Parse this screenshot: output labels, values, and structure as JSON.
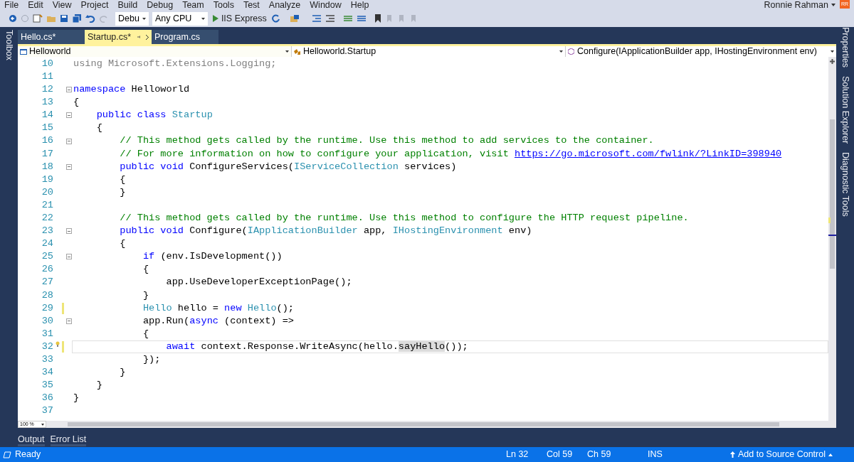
{
  "menu": [
    "File",
    "Edit",
    "View",
    "Project",
    "Build",
    "Debug",
    "Team",
    "Tools",
    "Test",
    "Analyze",
    "Window",
    "Help"
  ],
  "toolbar": {
    "configuration": "Debu",
    "platform": "Any CPU",
    "run_target": "IIS Express"
  },
  "user": {
    "name": "Ronnie Rahman",
    "initials": "RR"
  },
  "left_tabs": [
    "Toolbox"
  ],
  "doc_tabs": [
    {
      "label": "Hello.cs*",
      "selected": false
    },
    {
      "label": "Startup.cs*",
      "selected": true
    },
    {
      "label": "Program.cs",
      "selected": false
    }
  ],
  "nav": {
    "project": "Helloworld",
    "type": "Helloworld.Startup",
    "member": "Configure(IApplicationBuilder app, IHostingEnvironment env)"
  },
  "lines": [
    {
      "number": "10",
      "fold": false,
      "changed": false,
      "current": false,
      "lightbulb": false,
      "tokens": [
        {
          "kind": "dim",
          "text": "using Microsoft.Extensions.Logging;"
        }
      ]
    },
    {
      "number": "11",
      "fold": false,
      "changed": false,
      "current": false,
      "lightbulb": false
    },
    {
      "number": "12",
      "fold": true,
      "changed": false,
      "current": false,
      "lightbulb": false,
      "tokens": [
        {
          "kind": "kw",
          "text": "namespace"
        },
        {
          "kind": "p",
          "text": " Helloworld"
        }
      ]
    },
    {
      "number": "13",
      "fold": false,
      "changed": false,
      "current": false,
      "lightbulb": false,
      "tokens": [
        {
          "kind": "p",
          "text": "{"
        }
      ]
    },
    {
      "number": "14",
      "fold": true,
      "changed": false,
      "current": false,
      "lightbulb": false,
      "tokens": [
        {
          "kind": "kw",
          "text": "    public class"
        },
        {
          "kind": "ty",
          "text": " Startup"
        }
      ]
    },
    {
      "number": "15",
      "fold": false,
      "changed": false,
      "current": false,
      "lightbulb": false,
      "tokens": [
        {
          "kind": "p",
          "text": "    {"
        }
      ]
    },
    {
      "number": "16",
      "fold": true,
      "changed": false,
      "current": false,
      "lightbulb": false,
      "tokens": [
        {
          "kind": "cm",
          "text": "        // This method gets called by the runtime. Use this method to add services to the container."
        }
      ]
    },
    {
      "number": "17",
      "fold": false,
      "changed": false,
      "current": false,
      "lightbulb": false,
      "tokens": [
        {
          "kind": "cm",
          "text": "        // For more information on how to configure your application, visit "
        },
        {
          "kind": "link",
          "text": "https://go.microsoft.com/fwlink/?LinkID=398940"
        }
      ]
    },
    {
      "number": "18",
      "fold": true,
      "changed": false,
      "current": false,
      "lightbulb": false,
      "tokens": [
        {
          "kind": "kw",
          "text": "        public void"
        },
        {
          "kind": "p",
          "text": " ConfigureServices("
        },
        {
          "kind": "ty",
          "text": "IServiceCollection"
        },
        {
          "kind": "p",
          "text": " services)"
        }
      ]
    },
    {
      "number": "19",
      "fold": false,
      "changed": false,
      "current": false,
      "lightbulb": false,
      "tokens": [
        {
          "kind": "p",
          "text": "        {"
        }
      ]
    },
    {
      "number": "20",
      "fold": false,
      "changed": false,
      "current": false,
      "lightbulb": false,
      "tokens": [
        {
          "kind": "p",
          "text": "        }"
        }
      ]
    },
    {
      "number": "21",
      "fold": false,
      "changed": false,
      "current": false,
      "lightbulb": false
    },
    {
      "number": "22",
      "fold": false,
      "changed": false,
      "current": false,
      "lightbulb": false,
      "tokens": [
        {
          "kind": "cm",
          "text": "        // This method gets called by the runtime. Use this method to configure the HTTP request pipeline."
        }
      ]
    },
    {
      "number": "23",
      "fold": true,
      "changed": false,
      "current": false,
      "lightbulb": false,
      "tokens": [
        {
          "kind": "kw",
          "text": "        public void"
        },
        {
          "kind": "p",
          "text": " Configure("
        },
        {
          "kind": "ty",
          "text": "IApplicationBuilder"
        },
        {
          "kind": "p",
          "text": " app, "
        },
        {
          "kind": "ty",
          "text": "IHostingEnvironment"
        },
        {
          "kind": "p",
          "text": " env)"
        }
      ]
    },
    {
      "number": "24",
      "fold": false,
      "changed": false,
      "current": false,
      "lightbulb": false,
      "tokens": [
        {
          "kind": "p",
          "text": "        {"
        }
      ]
    },
    {
      "number": "25",
      "fold": true,
      "changed": false,
      "current": false,
      "lightbulb": false,
      "tokens": [
        {
          "kind": "kw",
          "text": "            if"
        },
        {
          "kind": "p",
          "text": " (env.IsDevelopment())"
        }
      ]
    },
    {
      "number": "26",
      "fold": false,
      "changed": false,
      "current": false,
      "lightbulb": false,
      "tokens": [
        {
          "kind": "p",
          "text": "            {"
        }
      ]
    },
    {
      "number": "27",
      "fold": false,
      "changed": false,
      "current": false,
      "lightbulb": false,
      "tokens": [
        {
          "kind": "p",
          "text": "                app.UseDeveloperExceptionPage();"
        }
      ]
    },
    {
      "number": "28",
      "fold": false,
      "changed": false,
      "current": false,
      "lightbulb": false,
      "tokens": [
        {
          "kind": "p",
          "text": "            }"
        }
      ]
    },
    {
      "number": "29",
      "fold": false,
      "changed": true,
      "current": false,
      "lightbulb": false,
      "tokens": [
        {
          "kind": "ty",
          "text": "            Hello"
        },
        {
          "kind": "p",
          "text": " hello = "
        },
        {
          "kind": "kw",
          "text": "new"
        },
        {
          "kind": "ty",
          "text": " Hello"
        },
        {
          "kind": "p",
          "text": "();"
        }
      ]
    },
    {
      "number": "30",
      "fold": true,
      "changed": false,
      "current": false,
      "lightbulb": false,
      "tokens": [
        {
          "kind": "p",
          "text": "            app.Run("
        },
        {
          "kind": "kw",
          "text": "async"
        },
        {
          "kind": "p",
          "text": " (context) =>"
        }
      ]
    },
    {
      "number": "31",
      "fold": false,
      "changed": false,
      "current": false,
      "lightbulb": false,
      "tokens": [
        {
          "kind": "p",
          "text": "            {"
        }
      ]
    },
    {
      "number": "32",
      "fold": false,
      "changed": true,
      "current": true,
      "lightbulb": true,
      "tokens": [
        {
          "kind": "kw",
          "text": "                await"
        },
        {
          "kind": "p",
          "text": " context.Response.WriteAsync(hello."
        },
        {
          "kind": "ref",
          "text": "sayHello"
        },
        {
          "kind": "p",
          "text": "());"
        }
      ]
    },
    {
      "number": "33",
      "fold": false,
      "changed": false,
      "current": false,
      "lightbulb": false,
      "tokens": [
        {
          "kind": "p",
          "text": "            });"
        }
      ]
    },
    {
      "number": "34",
      "fold": false,
      "changed": false,
      "current": false,
      "lightbulb": false,
      "tokens": [
        {
          "kind": "p",
          "text": "        }"
        }
      ]
    },
    {
      "number": "35",
      "fold": false,
      "changed": false,
      "current": false,
      "lightbulb": false,
      "tokens": [
        {
          "kind": "p",
          "text": "    }"
        }
      ]
    },
    {
      "number": "36",
      "fold": false,
      "changed": false,
      "current": false,
      "lightbulb": false,
      "tokens": [
        {
          "kind": "p",
          "text": "}"
        }
      ]
    },
    {
      "number": "37",
      "fold": false,
      "changed": false,
      "current": false,
      "lightbulb": false
    }
  ],
  "zoom": "100 %",
  "bottom_tabs": [
    "Output",
    "Error List"
  ],
  "right_tabs": [
    "Properties",
    "Solution Explorer",
    "Diagnostic Tools"
  ],
  "status": {
    "text": "Ready",
    "line": "Ln 32",
    "column": "Col 59",
    "char": "Ch 59",
    "mode": "INS",
    "source_control": "Add to Source Control"
  }
}
